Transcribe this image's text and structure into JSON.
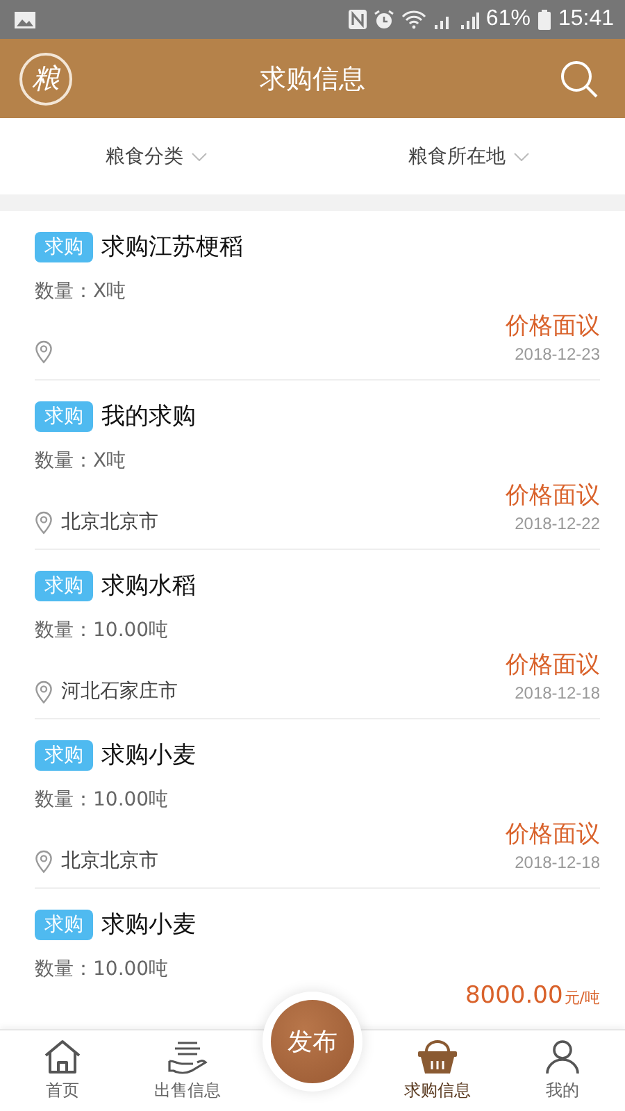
{
  "status_bar": {
    "battery": "61%",
    "time": "15:41"
  },
  "header": {
    "logo": "粮",
    "title": "求购信息"
  },
  "filters": [
    {
      "label": "粮食分类"
    },
    {
      "label": "粮食所在地"
    }
  ],
  "listings": [
    {
      "tag": "求购",
      "title": "求购江苏梗稻",
      "quantity": "数量：X吨",
      "price": "价格面议",
      "date": "2018-12-23"
    },
    {
      "tag": "求购",
      "title": "我的求购",
      "quantity": "数量：X吨",
      "location": "北京北京市",
      "price": "价格面议",
      "date": "2018-12-22"
    },
    {
      "tag": "求购",
      "title": "求购水稻",
      "quantity": "数量：10.00吨",
      "location": "河北石家庄市",
      "price": "价格面议",
      "date": "2018-12-18"
    },
    {
      "tag": "求购",
      "title": "求购小麦",
      "quantity": "数量：10.00吨",
      "location": "北京北京市",
      "price": "价格面议",
      "date": "2018-12-18"
    },
    {
      "tag": "求购",
      "title": "求购小麦",
      "quantity": "数量：10.00吨",
      "price": "8000.00",
      "price_unit": "元/吨"
    }
  ],
  "nav": {
    "items": [
      {
        "kind": "home",
        "label": "首页",
        "selected": false
      },
      {
        "kind": "sell",
        "label": "出售信息",
        "selected": false
      },
      {
        "kind": "basket",
        "label": "求购信息",
        "selected": true
      },
      {
        "kind": "person",
        "label": "我的",
        "selected": false
      }
    ],
    "publish": "发布"
  }
}
